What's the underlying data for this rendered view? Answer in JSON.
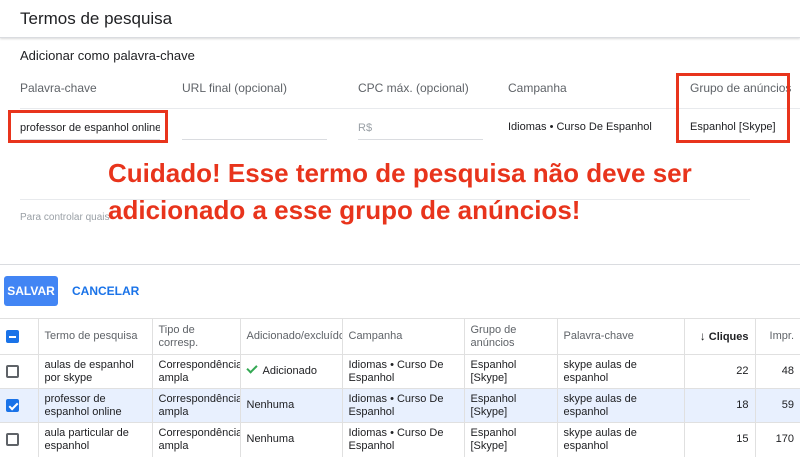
{
  "header": {
    "title": "Termos de pesquisa"
  },
  "form": {
    "section_title": "Adicionar como palavra-chave",
    "labels": {
      "keyword": "Palavra-chave",
      "final_url": "URL final (opcional)",
      "max_cpc": "CPC máx. (opcional)",
      "campaign": "Campanha",
      "ad_group": "Grupo de anúncios"
    },
    "keyword_value": "professor de espanhol online",
    "final_url_value": "",
    "cpc_placeholder": "R$",
    "campaign_value": "Idiomas • Curso De Espanhol",
    "ad_group_value": "Espanhol [Skype]",
    "hint": "Para controlar quais"
  },
  "annotation": {
    "warning_line1": "Cuidado! Esse termo de pesquisa não deve ser",
    "warning_line2": "adicionado a esse grupo de anúncios!",
    "color": "#e8341c"
  },
  "actions": {
    "save_label": "SALVAR",
    "cancel_label": "CANCELAR"
  },
  "table": {
    "headers": {
      "search_term": "Termo de pesquisa",
      "match_type": "Tipo de corresp.",
      "added_excluded": "Adicionado/excluído",
      "campaign": "Campanha",
      "ad_group": "Grupo de anúncios",
      "keyword": "Palavra-chave",
      "clicks": "Cliques",
      "impressions": "Impr."
    },
    "rows": [
      {
        "checked": false,
        "search_term": "aulas de espanhol por skype",
        "match_type": "Correspondência ampla",
        "status": "Adicionado",
        "campaign": "Idiomas • Curso De Espanhol",
        "ad_group": "Espanhol [Skype]",
        "keyword": "skype aulas de espanhol",
        "clicks": "22",
        "impressions": "48"
      },
      {
        "checked": true,
        "search_term": "professor de espanhol online",
        "match_type": "Correspondência ampla",
        "status": "Nenhuma",
        "campaign": "Idiomas • Curso De Espanhol",
        "ad_group": "Espanhol [Skype]",
        "keyword": "skype aulas de espanhol",
        "clicks": "18",
        "impressions": "59"
      },
      {
        "checked": false,
        "search_term": "aula particular de espanhol",
        "match_type": "Correspondência ampla",
        "status": "Nenhuma",
        "campaign": "Idiomas • Curso De Espanhol",
        "ad_group": "Espanhol [Skype]",
        "keyword": "skype aulas de espanhol",
        "clicks": "15",
        "impressions": "170"
      }
    ]
  },
  "colors": {
    "primary": "#4285f4",
    "link": "#1a73e8",
    "selected_row": "#e8f0fe",
    "success": "#34a853"
  }
}
